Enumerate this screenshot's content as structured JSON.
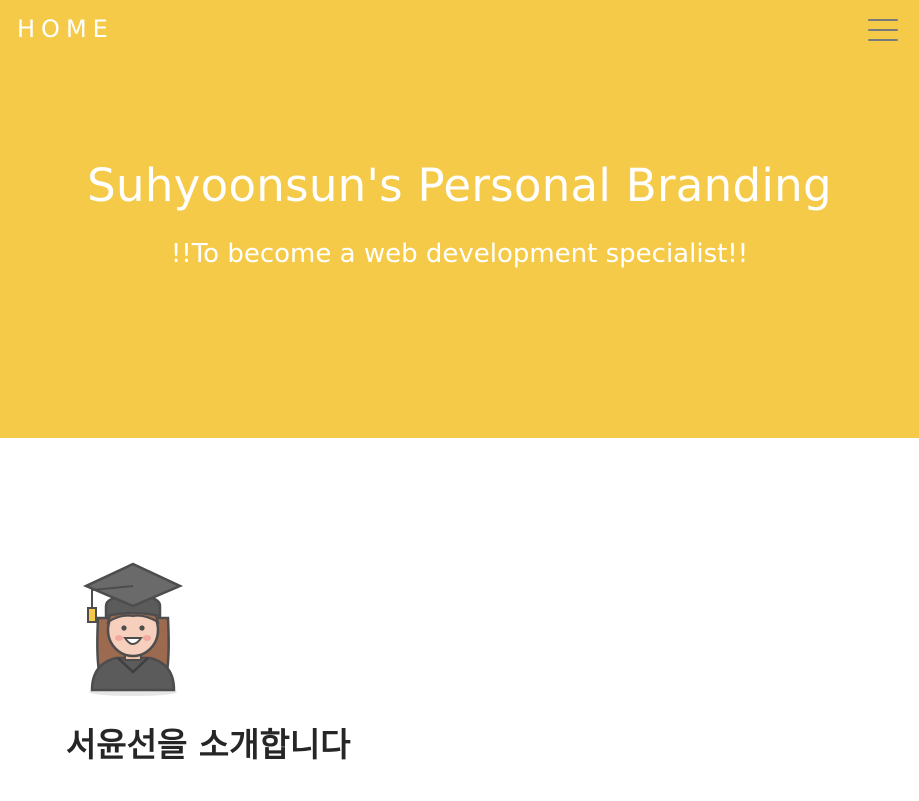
{
  "nav": {
    "home_label": "HOME",
    "menu_icon": "hamburger-menu-icon"
  },
  "hero": {
    "title": "Suhyoonsun's Personal Branding",
    "subtitle": "!!To become a web development specialist!!",
    "background_color": "#f5ca48"
  },
  "intro": {
    "avatar_icon": "graduate-woman-icon",
    "heading": "서윤선을 소개합니다"
  }
}
